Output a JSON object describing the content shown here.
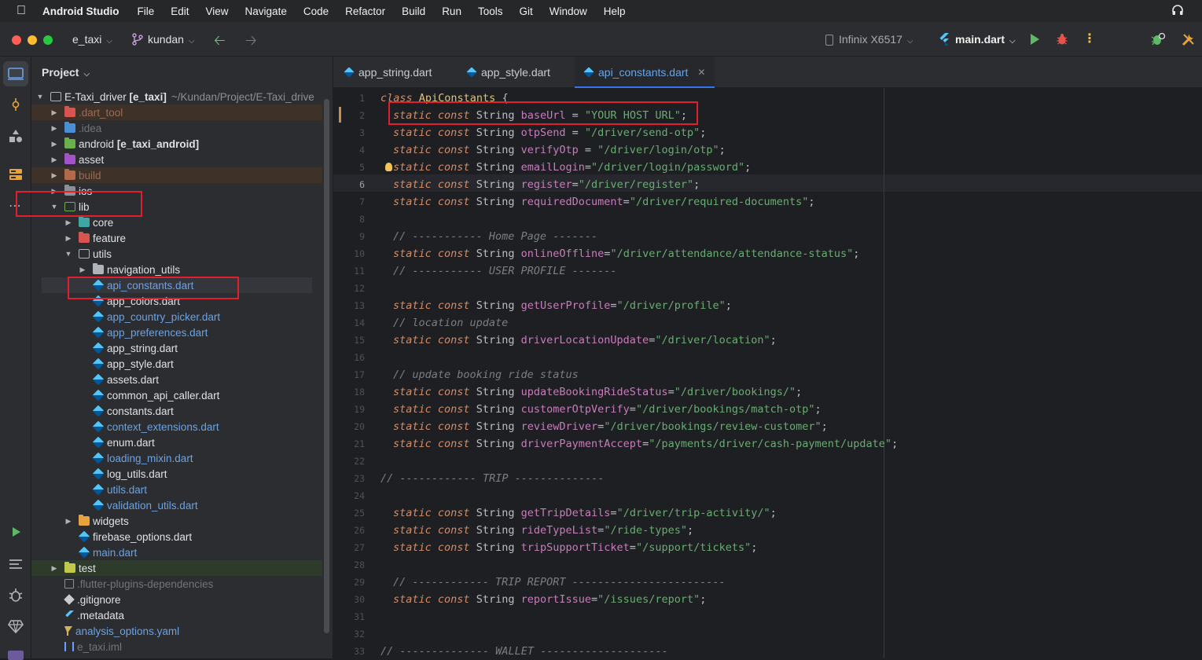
{
  "menubar": {
    "app_name": "Android Studio",
    "items": [
      "File",
      "Edit",
      "View",
      "Navigate",
      "Code",
      "Refactor",
      "Build",
      "Run",
      "Tools",
      "Git",
      "Window",
      "Help"
    ]
  },
  "toolbar": {
    "project_name": "e_taxi",
    "branch": "kundan",
    "device": "Infinix X6517",
    "run_config": "main.dart"
  },
  "project_panel": {
    "title": "Project",
    "root_name": "E-Taxi_driver",
    "root_module": "[e_taxi]",
    "root_path": "~/Kundan/Project/E-Taxi_drive",
    "items": {
      "dart_tool": ".dart_tool",
      "idea": ".idea",
      "android": "android",
      "android_module": "[e_taxi_android]",
      "asset": "asset",
      "build": "build",
      "ios": "ios",
      "lib": "lib",
      "core": "core",
      "feature": "feature",
      "utils": "utils",
      "navigation_utils": "navigation_utils",
      "api_constants": "api_constants.dart",
      "app_colors": "app_colors.dart",
      "app_country_picker": "app_country_picker.dart",
      "app_preferences": "app_preferences.dart",
      "app_string": "app_string.dart",
      "app_style": "app_style.dart",
      "assets": "assets.dart",
      "common_api_caller": "common_api_caller.dart",
      "constants": "constants.dart",
      "context_extensions": "context_extensions.dart",
      "enum": "enum.dart",
      "loading_mixin": "loading_mixin.dart",
      "log_utils": "log_utils.dart",
      "utils_dart": "utils.dart",
      "validation_utils": "validation_utils.dart",
      "widgets": "widgets",
      "firebase_options": "firebase_options.dart",
      "main": "main.dart",
      "test": "test",
      "flutter_plugins_deps": ".flutter-plugins-dependencies",
      "gitignore": ".gitignore",
      "metadata": ".metadata",
      "analysis_options": "analysis_options.yaml",
      "iml": "e_taxi.iml"
    }
  },
  "tabs": [
    {
      "label": "app_string.dart"
    },
    {
      "label": "app_style.dart"
    },
    {
      "label": "api_constants.dart"
    }
  ],
  "editor": {
    "line_numbers": [
      "1",
      "2",
      "3",
      "4",
      "5",
      "6",
      "7",
      "8",
      "9",
      "10",
      "11",
      "12",
      "13",
      "14",
      "15",
      "16",
      "17",
      "18",
      "19",
      "20",
      "21",
      "22",
      "23",
      "24",
      "25",
      "26",
      "27",
      "28",
      "29",
      "30",
      "31",
      "32",
      "33"
    ],
    "class_kw": "class",
    "class_name": "ApiConstants",
    "open_brace": " {",
    "static_kw": "static",
    "const_kw": "const",
    "string_type": "String",
    "constants": [
      {
        "name": "baseUrl",
        "sep": " = ",
        "value": "\"YOUR HOST URL\""
      },
      {
        "name": "otpSend",
        "sep": " = ",
        "value": "\"/driver/send-otp\""
      },
      {
        "name": "verifyOtp",
        "sep": " = ",
        "value": "\"/driver/login/otp\""
      },
      {
        "name": "emailLogin",
        "sep": "=",
        "value": "\"/driver/login/password\""
      },
      {
        "name": "register",
        "sep": "=",
        "value": "\"/driver/register\""
      },
      {
        "name": "requiredDocument",
        "sep": "=",
        "value": "\"/driver/required-documents\""
      },
      {
        "name": "onlineOffline",
        "sep": "=",
        "value": "\"/driver/attendance/attendance-status\""
      },
      {
        "name": "getUserProfile",
        "sep": "=",
        "value": "\"/driver/profile\""
      },
      {
        "name": "driverLocationUpdate",
        "sep": "=",
        "value": "\"/driver/location\""
      },
      {
        "name": "updateBookingRideStatus",
        "sep": "=",
        "value": "\"/driver/bookings/\""
      },
      {
        "name": "customerOtpVerify",
        "sep": "=",
        "value": "\"/driver/bookings/match-otp\""
      },
      {
        "name": "reviewDriver",
        "sep": "=",
        "value": "\"/driver/bookings/review-customer\""
      },
      {
        "name": "driverPaymentAccept",
        "sep": "=",
        "value": "\"/payments/driver/cash-payment/update\""
      },
      {
        "name": "getTripDetails",
        "sep": "=",
        "value": "\"/driver/trip-activity/\""
      },
      {
        "name": "rideTypeList",
        "sep": "=",
        "value": "\"/ride-types\""
      },
      {
        "name": "tripSupportTicket",
        "sep": "=",
        "value": "\"/support/tickets\""
      },
      {
        "name": "reportIssue",
        "sep": "=",
        "value": "\"/issues/report\""
      }
    ],
    "semicolon": ";",
    "comments": {
      "home_page": "// ----------- Home Page -------",
      "user_profile": "// ----------- USER PROFILE -------",
      "location_update": "// location update",
      "update_booking": "// update booking ride status",
      "trip": "// ------------ TRIP --------------",
      "trip_report": "// ------------ TRIP REPORT ------------------------",
      "wallet": "// -------------- WALLET --------------------"
    }
  },
  "colors": {
    "highlight_box": "#e0202e",
    "keyword": "#cf8e6d",
    "variable": "#c77dbb",
    "string": "#6aab73",
    "comment": "#7a7e85"
  }
}
